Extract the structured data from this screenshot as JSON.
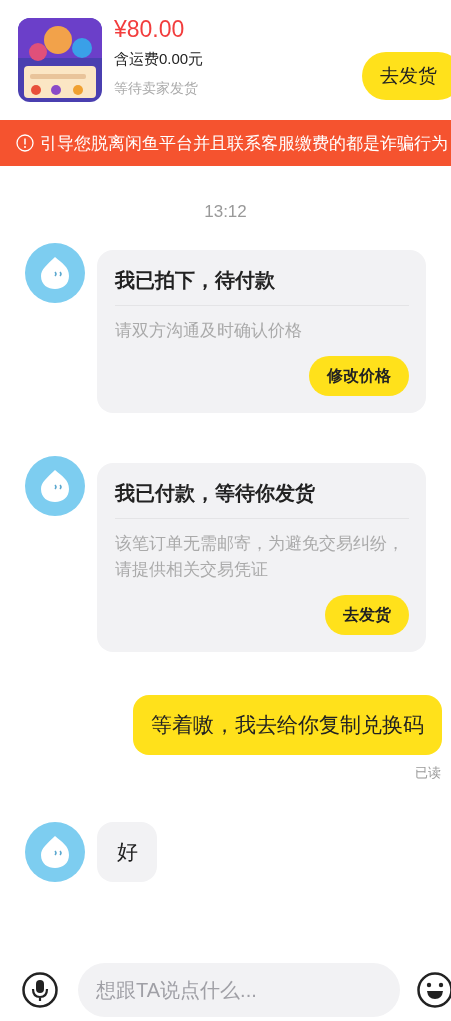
{
  "order": {
    "price": "¥80.00",
    "shipping": "含运费0.00元",
    "status": "等待卖家发货",
    "action": "去发货"
  },
  "warning": "引导您脱离闲鱼平台并且联系客服缴费的都是诈骗行为",
  "timestamp": "13:12",
  "messages": [
    {
      "kind": "card",
      "title": "我已拍下，待付款",
      "body": "请双方沟通及时确认价格",
      "action": "修改价格"
    },
    {
      "kind": "card",
      "title": "我已付款，等待你发货",
      "body": "该笔订单无需邮寄，为避免交易纠纷，请提供相关交易凭证",
      "action": "去发货"
    },
    {
      "kind": "text",
      "outgoing": true,
      "text": "等着嗷，我去给你复制兑换码",
      "receipt": "已读"
    },
    {
      "kind": "text",
      "outgoing": false,
      "text": "好"
    }
  ],
  "input": {
    "placeholder": "想跟TA说点什么..."
  }
}
